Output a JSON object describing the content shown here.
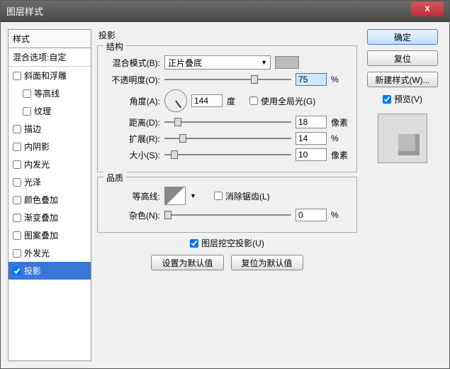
{
  "window": {
    "title": "图层样式"
  },
  "styles": {
    "header": "样式",
    "blend_options": "混合选项:自定",
    "items": [
      {
        "label": "斜面和浮雕",
        "checked": false,
        "indent": false
      },
      {
        "label": "等高线",
        "checked": false,
        "indent": true
      },
      {
        "label": "纹理",
        "checked": false,
        "indent": true
      },
      {
        "label": "描边",
        "checked": false,
        "indent": false
      },
      {
        "label": "内阴影",
        "checked": false,
        "indent": false
      },
      {
        "label": "内发光",
        "checked": false,
        "indent": false
      },
      {
        "label": "光泽",
        "checked": false,
        "indent": false
      },
      {
        "label": "颜色叠加",
        "checked": false,
        "indent": false
      },
      {
        "label": "渐变叠加",
        "checked": false,
        "indent": false
      },
      {
        "label": "图案叠加",
        "checked": false,
        "indent": false
      },
      {
        "label": "外发光",
        "checked": false,
        "indent": false
      },
      {
        "label": "投影",
        "checked": true,
        "indent": false,
        "selected": true
      }
    ]
  },
  "main": {
    "title": "投影",
    "structure": {
      "legend": "结构",
      "blend_mode_label": "混合模式(B):",
      "blend_mode_value": "正片叠底",
      "opacity_label": "不透明度(O):",
      "opacity_value": "75",
      "opacity_unit": "%",
      "angle_label": "角度(A):",
      "angle_value": "144",
      "angle_unit": "度",
      "global_light_label": "使用全局光(G)",
      "global_light_checked": false,
      "distance_label": "距离(D):",
      "distance_value": "18",
      "distance_unit": "像素",
      "spread_label": "扩展(R):",
      "spread_value": "14",
      "spread_unit": "%",
      "size_label": "大小(S):",
      "size_value": "10",
      "size_unit": "像素"
    },
    "quality": {
      "legend": "品质",
      "contour_label": "等高线:",
      "antialias_label": "消除锯齿(L)",
      "antialias_checked": false,
      "noise_label": "杂色(N):",
      "noise_value": "0",
      "noise_unit": "%"
    },
    "knockout_label": "图层挖空投影(U)",
    "knockout_checked": true,
    "make_default": "设置为默认值",
    "reset_default": "复位为默认值"
  },
  "side": {
    "ok": "确定",
    "cancel": "复位",
    "new_style": "新建样式(W)...",
    "preview_label": "预览(V)",
    "preview_checked": true
  }
}
